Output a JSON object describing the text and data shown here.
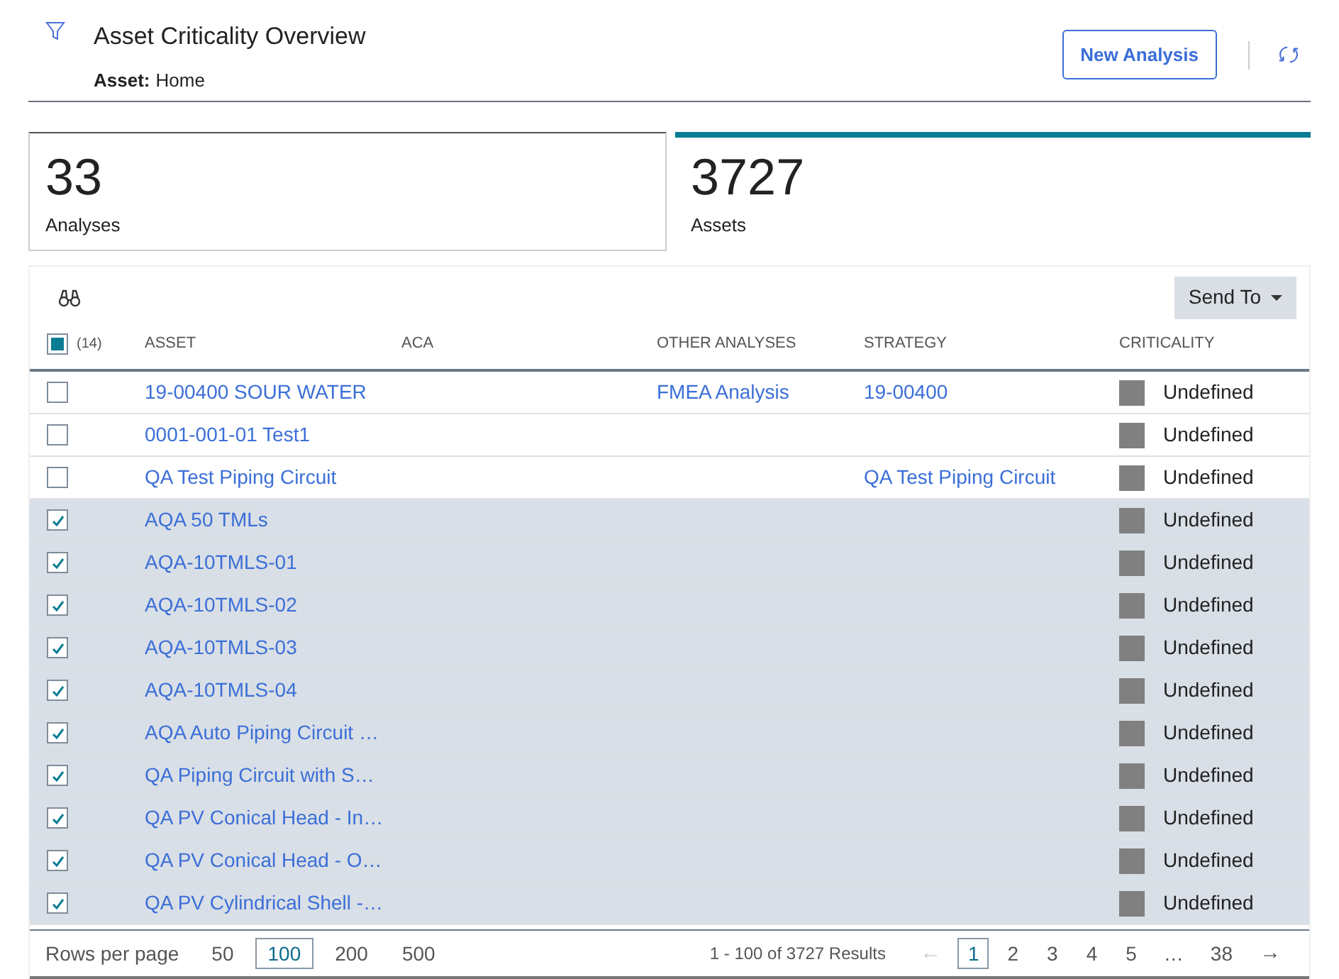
{
  "header": {
    "title": "Asset Criticality Overview",
    "asset_label": "Asset:",
    "asset_value": "Home",
    "new_button": "New Analysis"
  },
  "summary_cards": [
    {
      "count": "33",
      "label": "Analyses",
      "selected": false
    },
    {
      "count": "3727",
      "label": "Assets",
      "selected": true
    }
  ],
  "toolbar": {
    "send_to": "Send To"
  },
  "table": {
    "select_all": {
      "checked": true,
      "count": "(14)"
    },
    "columns": [
      "ASSET",
      "ACA",
      "OTHER ANALYSES",
      "STRATEGY",
      "CRITICALITY"
    ],
    "rows": [
      {
        "checked": false,
        "asset": "19-00400 SOUR WATER",
        "other_analyses": "FMEA Analysis",
        "strategy": "19-00400",
        "criticality": "Undefined",
        "color": "#808080"
      },
      {
        "checked": false,
        "asset": "0001-001-01 Test1",
        "criticality": "Undefined",
        "color": "#808080"
      },
      {
        "checked": false,
        "asset": "QA Test Piping Circuit",
        "strategy": "QA Test Piping Circuit",
        "criticality": "Undefined",
        "color": "#808080"
      },
      {
        "checked": true,
        "asset": "AQA 50 TMLs",
        "criticality": "Undefined",
        "color": "#808080"
      },
      {
        "checked": true,
        "asset": "AQA-10TMLS-01",
        "criticality": "Undefined",
        "color": "#808080"
      },
      {
        "checked": true,
        "asset": "AQA-10TMLS-02",
        "criticality": "Undefined",
        "color": "#808080"
      },
      {
        "checked": true,
        "asset": "AQA-10TMLS-03",
        "criticality": "Undefined",
        "color": "#808080"
      },
      {
        "checked": true,
        "asset": "AQA-10TMLS-04",
        "criticality": "Undefined",
        "color": "#808080"
      },
      {
        "checked": true,
        "asset": "AQA Auto Piping Circuit …",
        "criticality": "Undefined",
        "color": "#808080"
      },
      {
        "checked": true,
        "asset": "QA Piping Circuit with S…",
        "criticality": "Undefined",
        "color": "#808080"
      },
      {
        "checked": true,
        "asset": "QA PV Conical Head - In…",
        "criticality": "Undefined",
        "color": "#808080"
      },
      {
        "checked": true,
        "asset": "QA PV Conical Head - O…",
        "criticality": "Undefined",
        "color": "#808080"
      },
      {
        "checked": true,
        "asset": "QA PV Cylindrical Shell -…",
        "criticality": "Undefined",
        "color": "#808080"
      }
    ]
  },
  "footer": {
    "rows_per_page_label": "Rows per page",
    "page_sizes": [
      {
        "label": "50",
        "selected": false
      },
      {
        "label": "100",
        "selected": true
      },
      {
        "label": "200",
        "selected": false
      },
      {
        "label": "500",
        "selected": false
      }
    ],
    "results": "1 - 100 of 3727 Results",
    "prev": "←",
    "next": "→",
    "pages": [
      {
        "label": "1",
        "kind": "page",
        "selected": true
      },
      {
        "label": "2",
        "kind": "page",
        "selected": false
      },
      {
        "label": "3",
        "kind": "page",
        "selected": false
      },
      {
        "label": "4",
        "kind": "page",
        "selected": false
      },
      {
        "label": "5",
        "kind": "page",
        "selected": false
      },
      {
        "label": "…",
        "kind": "ellipsis"
      },
      {
        "label": "38",
        "kind": "page",
        "selected": false
      }
    ]
  }
}
